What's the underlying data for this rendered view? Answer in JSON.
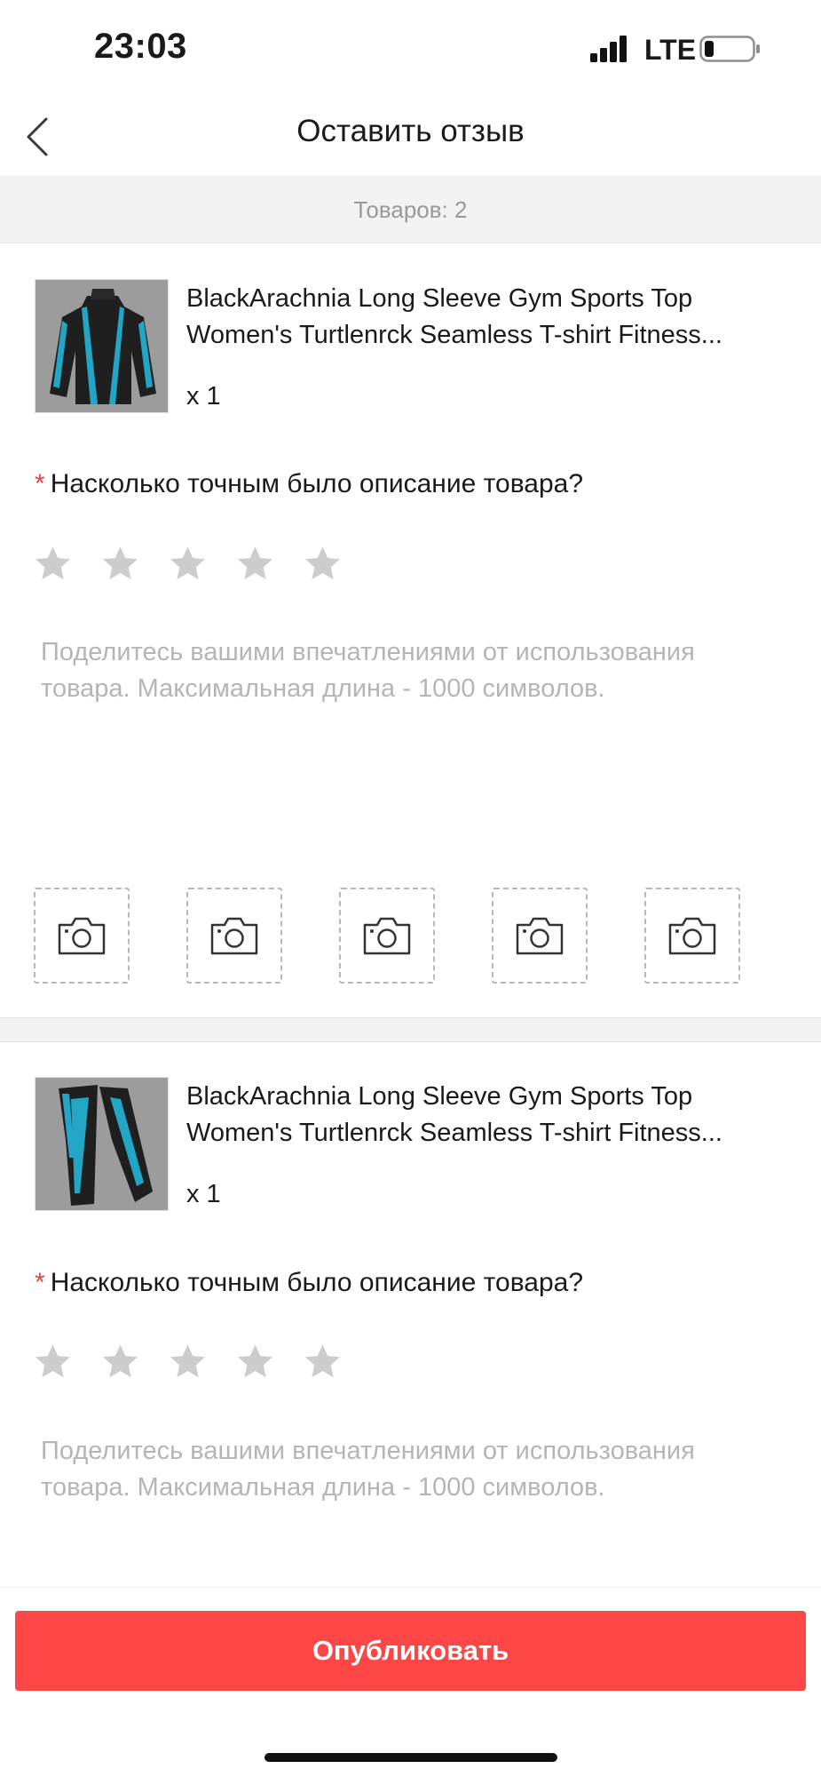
{
  "status_bar": {
    "time": "23:03",
    "network": "LTE",
    "icons": [
      "signal-icon",
      "battery-icon"
    ]
  },
  "header": {
    "title": "Оставить отзыв",
    "back_icon": "chevron-left-icon"
  },
  "count_bar": {
    "text": "Товаров: 2"
  },
  "products": [
    {
      "title": "BlackArachnia Long Sleeve Gym Sports Top Women's Turtlenrck Seamless T-shirt Fitness...",
      "qty": "x 1",
      "question": "Насколько точным было описание товара?",
      "required_mark": "*",
      "rating": 0,
      "rating_max": 5,
      "review_placeholder": "Поделитесь вашими впечатлениями от использования товара. Максимальная длина - 1000 символов.",
      "review_value": "",
      "photo_slots": 5,
      "photo_icon": "camera-icon"
    },
    {
      "title": "BlackArachnia Long Sleeve Gym Sports Top Women's Turtlenrck Seamless T-shirt Fitness...",
      "qty": "x 1",
      "question": "Насколько точным было описание товара?",
      "required_mark": "*",
      "rating": 0,
      "rating_max": 5,
      "review_placeholder": "Поделитесь вашими впечатлениями от использования товара. Максимальная длина - 1000 символов.",
      "review_value": ""
    }
  ],
  "footer": {
    "publish_label": "Опубликовать"
  },
  "colors": {
    "accent": "#fd4747",
    "required": "#e8403f",
    "star_inactive": "#cccccc",
    "placeholder": "#b5b5b5",
    "divider_bg": "#f2f2f2",
    "thumb_teal": "#23a5c6"
  }
}
